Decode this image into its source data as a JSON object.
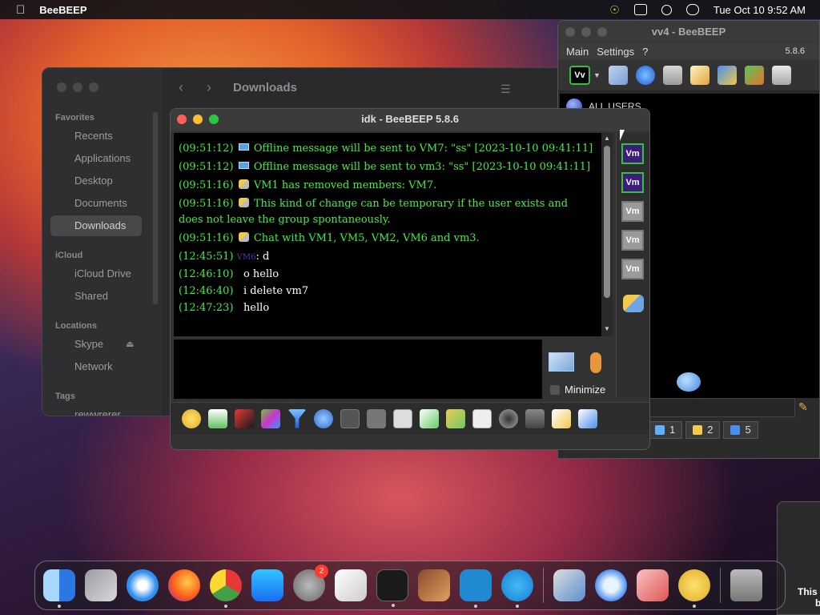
{
  "menubar": {
    "app_name": "BeeBEEP",
    "clock": "Tue Oct 10  9:52 AM"
  },
  "finder": {
    "title": "Downloads",
    "sections": {
      "favorites": "Favorites",
      "icloud": "iCloud",
      "locations": "Locations",
      "tags": "Tags"
    },
    "favorites": [
      "Recents",
      "Applications",
      "Desktop",
      "Documents",
      "Downloads"
    ],
    "icloud_items": [
      "iCloud Drive",
      "Shared"
    ],
    "locations_items": [
      "Skype",
      "Network"
    ],
    "tags_items": [
      "rewwrerer"
    ]
  },
  "main_window": {
    "title": "vv4 - BeeBEEP",
    "menu": [
      "Main",
      "Settings",
      "?"
    ],
    "version": "5.8.6",
    "user_button": "Vv",
    "all_users": "ALL USERS",
    "tabs": [
      {
        "label": "1"
      },
      {
        "label": "2"
      },
      {
        "label": "5"
      }
    ]
  },
  "chat_window": {
    "title": "idk - BeeBEEP 5.8.6",
    "messages": [
      {
        "time": "(09:51:12)",
        "icon": "envelope-icon",
        "text": "Offline message will be sent to VM7: \"ss\" [2023-10-10 09:41:11]"
      },
      {
        "time": "(09:51:12)",
        "icon": "envelope-icon",
        "text": "Offline message will be sent to vm3: \"ss\" [2023-10-10 09:41:11]"
      },
      {
        "time": "(09:51:16)",
        "icon": "users-icon",
        "text": "VM1 has removed members: VM7."
      },
      {
        "time": "(09:51:16)",
        "icon": "users-icon",
        "text": "This kind of change can be temporary if the user exists and does not leave the group spontaneously."
      },
      {
        "time": "(09:51:16)",
        "icon": "users-icon",
        "text": "Chat with VM1, VM5, VM2, VM6 and vm3."
      },
      {
        "time": "(12:45:51)",
        "sender": "VM6",
        "text": ": d"
      },
      {
        "time": "(12:46:10)",
        "text": "o hello"
      },
      {
        "time": "(12:46:40)",
        "text": "i delete vm7"
      },
      {
        "time": "(12:47:23)",
        "text": "hello"
      }
    ],
    "members": [
      "Vm",
      "Vm",
      "Vm",
      "Vm",
      "Vm"
    ],
    "minimize_label": "Minimize"
  },
  "dock": {
    "settings_badge": "2"
  },
  "notice": {
    "text_line1": "This",
    "text_line2": "b"
  },
  "colors": {
    "chat_text": "#3ef03e",
    "member_border": "#35c23b",
    "member_purple": "#3c1d7a"
  }
}
